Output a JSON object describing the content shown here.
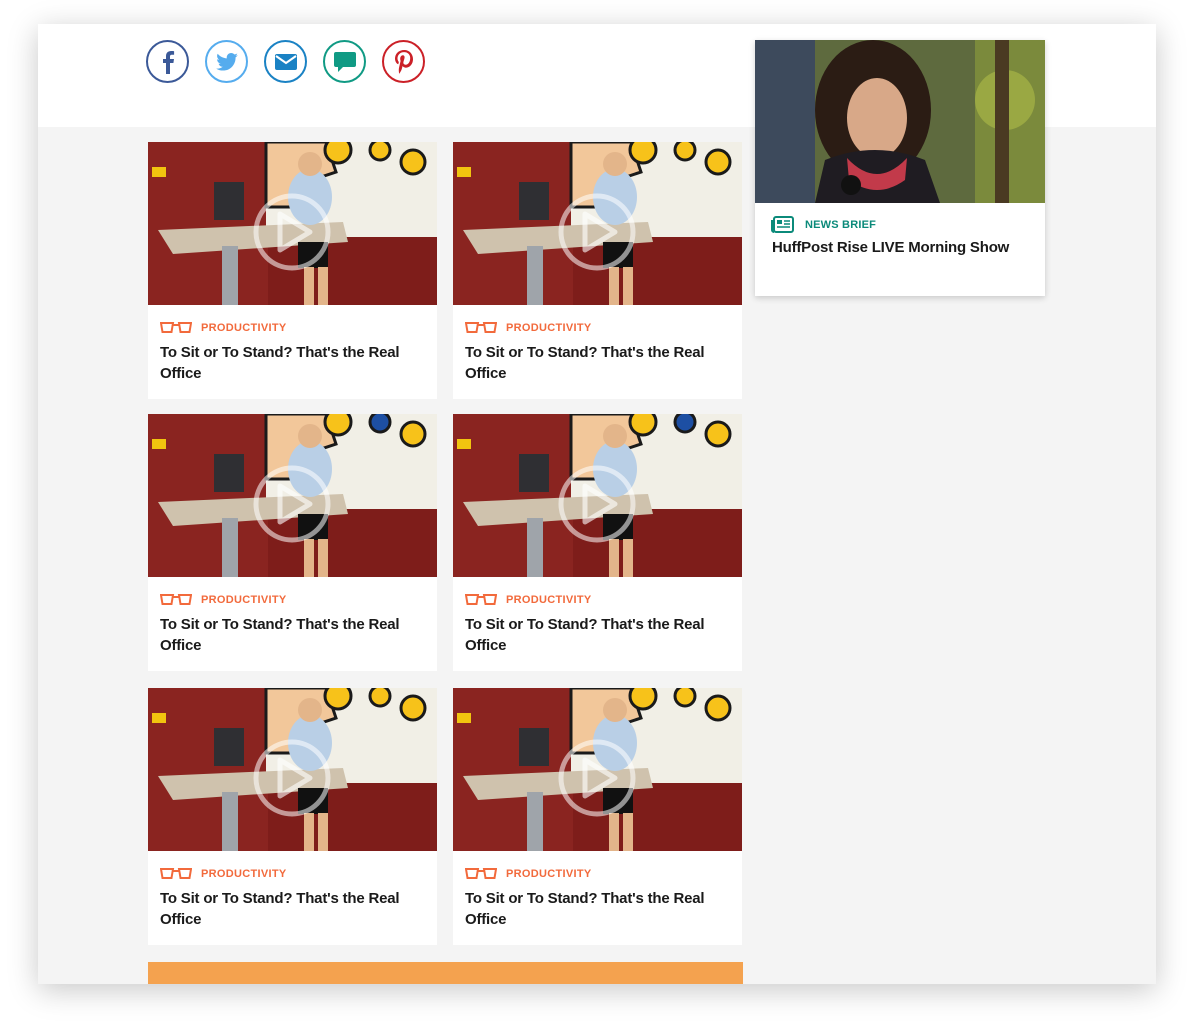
{
  "share": {
    "buttons": [
      {
        "name": "facebook",
        "icon": "facebook-icon",
        "color": "#3b5998"
      },
      {
        "name": "twitter",
        "icon": "twitter-icon",
        "color": "#55acee"
      },
      {
        "name": "email",
        "icon": "email-icon",
        "color": "#1a82c4"
      },
      {
        "name": "comment",
        "icon": "comment-icon",
        "color": "#109a84"
      },
      {
        "name": "pinterest",
        "icon": "pinterest-icon",
        "color": "#cb2027"
      }
    ]
  },
  "cards": [
    {
      "category": "PRODUCTIVITY",
      "title": "To Sit or To Stand? That's the Real Office"
    },
    {
      "category": "PRODUCTIVITY",
      "title": "To Sit or To Stand? That's the Real Office"
    },
    {
      "category": "PRODUCTIVITY",
      "title": "To Sit or To Stand? That's the Real Office"
    },
    {
      "category": "PRODUCTIVITY",
      "title": "To Sit or To Stand? That's the Real Office"
    },
    {
      "category": "PRODUCTIVITY",
      "title": "To Sit or To Stand? That's the Real Office"
    },
    {
      "category": "PRODUCTIVITY",
      "title": "To Sit or To Stand? That's the Real Office"
    }
  ],
  "sidebar": {
    "tag": "NEWS BRIEF",
    "title": "HuffPost Rise LIVE Morning Show"
  },
  "colors": {
    "accent_orange": "#f26a3c",
    "teal": "#0b8a7a",
    "bar_orange": "#f4a24f"
  }
}
